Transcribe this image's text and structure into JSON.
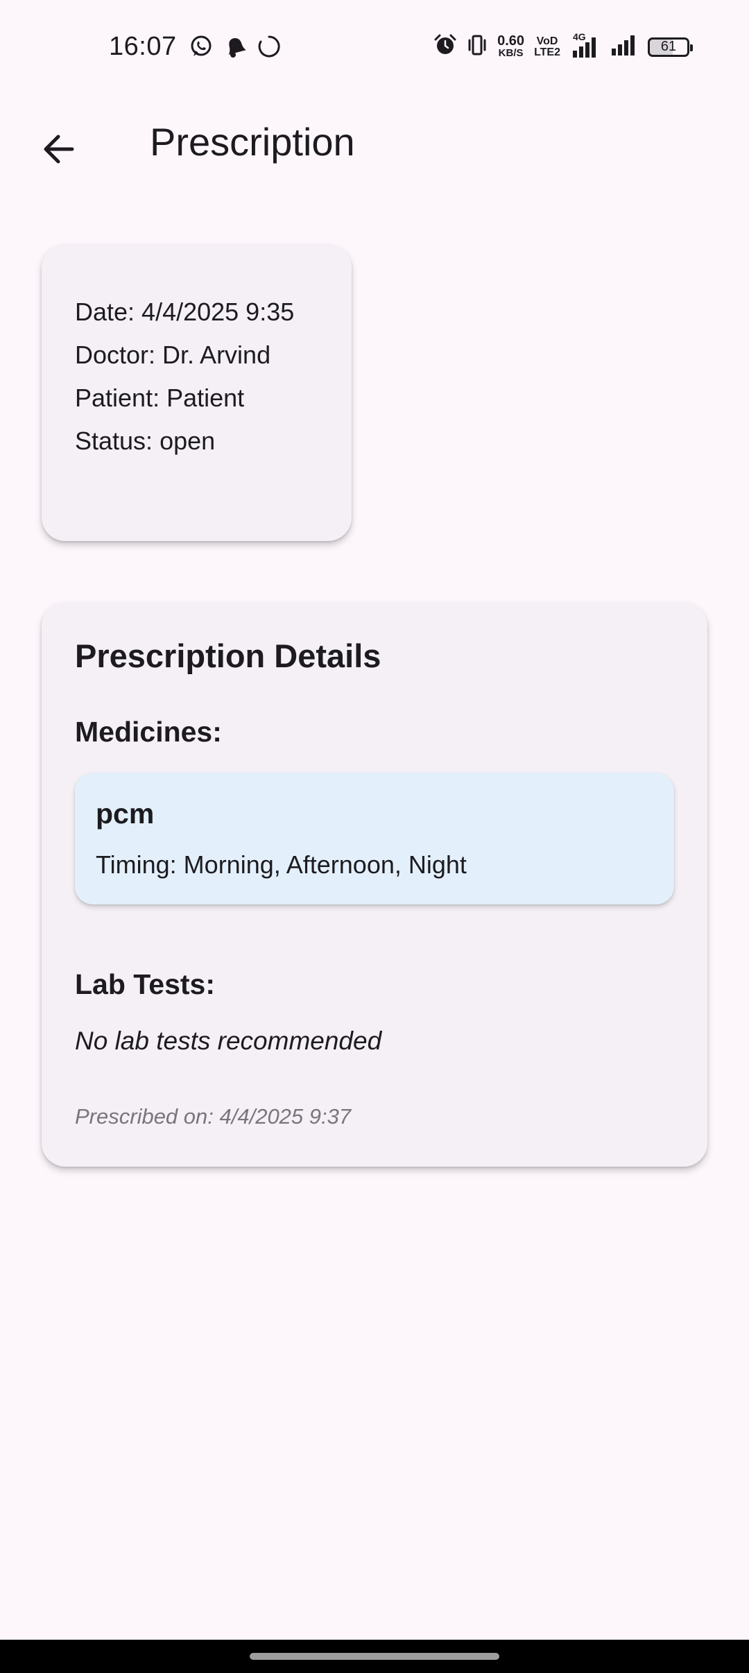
{
  "status_bar": {
    "time": "16:07",
    "left_icons": [
      "whatsapp-icon",
      "notification-bell-icon",
      "loading-circle-icon"
    ],
    "right_icons": [
      "alarm-icon",
      "vibrate-icon",
      "data-speed",
      "volte-icon",
      "signal-4g-icon",
      "signal-icon",
      "battery-icon"
    ],
    "speed_value": "0.60",
    "speed_unit": "KB/S",
    "volte_top": "VoD",
    "volte_bottom": "LTE2",
    "network_type": "4G",
    "battery_level": "61"
  },
  "app_bar": {
    "title": "Prescription",
    "back_icon": "arrow-back-icon"
  },
  "summary": {
    "date": "Date: 4/4/2025 9:35",
    "doctor": "Doctor: Dr. Arvind",
    "patient": "Patient: Patient",
    "status": "Status: open"
  },
  "details": {
    "title": "Prescription Details",
    "medicines_heading": "Medicines:",
    "medicines": [
      {
        "name": "pcm",
        "timing": "Timing: Morning, Afternoon, Night"
      }
    ],
    "lab_tests_heading": "Lab Tests:",
    "lab_tests_empty": "No lab tests recommended",
    "prescribed_on": "Prescribed on: 4/4/2025 9:37"
  },
  "colors": {
    "background": "#fdf7fc",
    "card": "#f4f0f5",
    "medicine_card": "#e3f0fb",
    "text": "#1d1b20",
    "muted_text": "#79747e"
  }
}
